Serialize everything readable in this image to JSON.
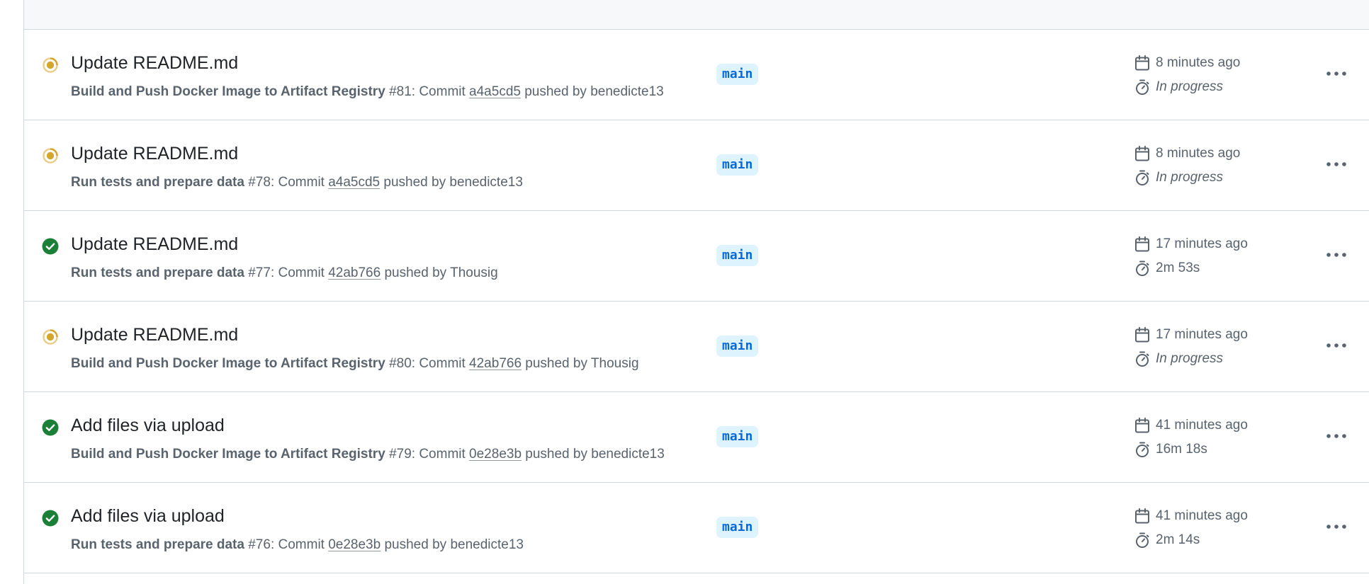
{
  "colors": {
    "in_progress": "#d4a72c",
    "success": "#1a7f37",
    "branch_bg": "#ddf4ff",
    "branch_text": "#0969da",
    "muted_text": "#59636e",
    "border": "#d1d9e0"
  },
  "runs": [
    {
      "status": "in_progress",
      "status_icon": "in-progress-icon",
      "title": "Update README.md",
      "workflow": "Build and Push Docker Image to Artifact Registry",
      "run_number": "#81",
      "commit_prefix": ": Commit ",
      "sha": "a4a5cd5",
      "pushed_by_prefix": " pushed by ",
      "actor": "benedicte13",
      "branch": "main",
      "created": "8 minutes ago",
      "duration": "In progress",
      "more_icon": "kebab-horizontal-icon"
    },
    {
      "status": "in_progress",
      "status_icon": "in-progress-icon",
      "title": "Update README.md",
      "workflow": "Run tests and prepare data",
      "run_number": "#78",
      "commit_prefix": ": Commit ",
      "sha": "a4a5cd5",
      "pushed_by_prefix": " pushed by ",
      "actor": "benedicte13",
      "branch": "main",
      "created": "8 minutes ago",
      "duration": "In progress",
      "more_icon": "kebab-horizontal-icon"
    },
    {
      "status": "success",
      "status_icon": "check-circle-icon",
      "title": "Update README.md",
      "workflow": "Run tests and prepare data",
      "run_number": "#77",
      "commit_prefix": ": Commit ",
      "sha": "42ab766",
      "pushed_by_prefix": " pushed by ",
      "actor": "Thousig",
      "branch": "main",
      "created": "17 minutes ago",
      "duration": "2m 53s",
      "more_icon": "kebab-horizontal-icon"
    },
    {
      "status": "in_progress",
      "status_icon": "in-progress-icon",
      "title": "Update README.md",
      "workflow": "Build and Push Docker Image to Artifact Registry",
      "run_number": "#80",
      "commit_prefix": ": Commit ",
      "sha": "42ab766",
      "pushed_by_prefix": " pushed by ",
      "actor": "Thousig",
      "branch": "main",
      "created": "17 minutes ago",
      "duration": "In progress",
      "more_icon": "kebab-horizontal-icon"
    },
    {
      "status": "success",
      "status_icon": "check-circle-icon",
      "title": "Add files via upload",
      "workflow": "Build and Push Docker Image to Artifact Registry",
      "run_number": "#79",
      "commit_prefix": ": Commit ",
      "sha": "0e28e3b",
      "pushed_by_prefix": " pushed by ",
      "actor": "benedicte13",
      "branch": "main",
      "created": "41 minutes ago",
      "duration": "16m 18s",
      "more_icon": "kebab-horizontal-icon"
    },
    {
      "status": "success",
      "status_icon": "check-circle-icon",
      "title": "Add files via upload",
      "workflow": "Run tests and prepare data",
      "run_number": "#76",
      "commit_prefix": ": Commit ",
      "sha": "0e28e3b",
      "pushed_by_prefix": " pushed by ",
      "actor": "benedicte13",
      "branch": "main",
      "created": "41 minutes ago",
      "duration": "2m 14s",
      "more_icon": "kebab-horizontal-icon"
    }
  ]
}
